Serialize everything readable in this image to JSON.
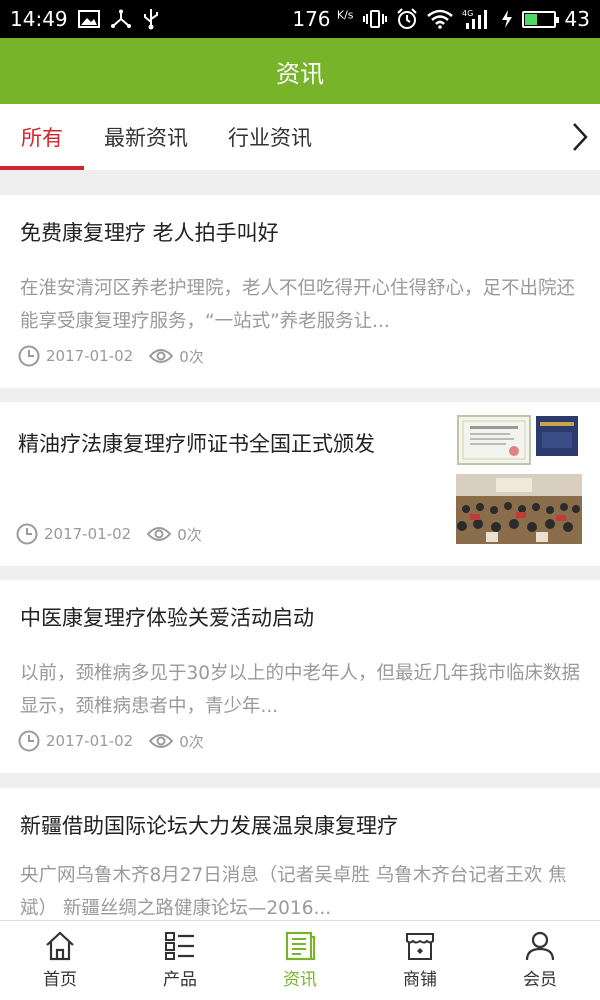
{
  "status_bar": {
    "time": "14:49",
    "net_speed": "176",
    "net_unit": "K/s",
    "network": "4G",
    "battery": "43",
    "battery_level": 0.43,
    "icons": [
      "image-icon",
      "share-icon",
      "usb-icon",
      "vibrate-icon",
      "alarm-icon",
      "wifi-icon",
      "signal-icon",
      "charging-icon",
      "battery-icon"
    ]
  },
  "header": {
    "title": "资讯"
  },
  "tabs": [
    {
      "label": "所有",
      "active": true
    },
    {
      "label": "最新资讯",
      "active": false
    },
    {
      "label": "行业资讯",
      "active": false
    }
  ],
  "news": [
    {
      "title": "免费康复理疗 老人拍手叫好",
      "summary": "在淮安清河区养老护理院，老人不但吃得开心住得舒心，足不出院还能享受康复理疗服务，“一站式”养老服务让...",
      "date": "2017-01-02",
      "views": "0次"
    },
    {
      "title": "精油疗法康复理疗师证书全国正式颁发",
      "date": "2017-01-02",
      "views": "0次",
      "image": "certificate-and-classroom-photo"
    },
    {
      "title": "中医康复理疗体验关爱活动启动",
      "summary": " 以前，颈椎病多见于30岁以上的中老年人，但最近几年我市临床数据显示，颈椎病患者中，青少年...",
      "date": "2017-01-02",
      "views": "0次"
    },
    {
      "title": "新疆借助国际论坛大力发展温泉康复理疗",
      "summary": "央广网乌鲁木齐8月27日消息（记者吴卓胜 乌鲁木齐台记者王欢 焦斌） 新疆丝绸之路健康论坛—2016...",
      "date": "",
      "views": ""
    }
  ],
  "bottom_nav": [
    {
      "label": "首页",
      "icon": "home-icon",
      "active": false
    },
    {
      "label": "产品",
      "icon": "list-icon",
      "active": false
    },
    {
      "label": "资讯",
      "icon": "news-icon",
      "active": true
    },
    {
      "label": "商铺",
      "icon": "shop-icon",
      "active": false
    },
    {
      "label": "会员",
      "icon": "user-icon",
      "active": false
    }
  ],
  "colors": {
    "brand": "#77b42a",
    "tab_active": "#d0262b",
    "muted_text": "#9a9a9a"
  }
}
